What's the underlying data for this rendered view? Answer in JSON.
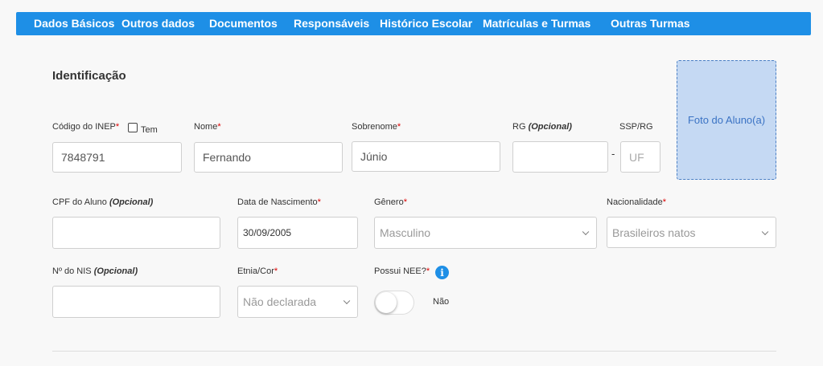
{
  "nav": {
    "tabs": [
      "Dados Básicos",
      "Outros dados",
      "Documentos",
      "Responsáveis",
      "Histórico Escolar",
      "Matrículas e Turmas",
      "Outras Turmas"
    ]
  },
  "section": {
    "title": "Identificação"
  },
  "form": {
    "inep": {
      "label": "Código do INEP",
      "req": "*",
      "checkbox_label": "Tem",
      "value": "7848791"
    },
    "nome": {
      "label": "Nome",
      "req": "*",
      "value": "Fernando"
    },
    "sobrenome": {
      "label": "Sobrenome",
      "req": "*",
      "value": "Júnio"
    },
    "rg": {
      "label": "RG",
      "opt": "(Opcional)",
      "value": ""
    },
    "ssp": {
      "label": "SSP/RG",
      "separator": "-",
      "placeholder": "UF"
    },
    "cpf": {
      "label": "CPF do Aluno",
      "opt": "(Opcional)",
      "value": ""
    },
    "nascimento": {
      "label": "Data de Nascimento",
      "req": "*",
      "value": "30/09/2005"
    },
    "genero": {
      "label": "Gênero",
      "req": "*",
      "value": "Masculino"
    },
    "nacionalidade": {
      "label": "Nacionalidade",
      "req": "*",
      "value": "Brasileiros natos"
    },
    "nis": {
      "label": "Nº do NIS",
      "opt": "(Opcional)",
      "value": ""
    },
    "etnia": {
      "label": "Etnia/Cor",
      "req": "*",
      "value": "Não declarada"
    },
    "nee": {
      "label": "Possui NEE?",
      "req": "*",
      "state_label": "Não",
      "on": false
    }
  },
  "photo": {
    "label": "Foto do Aluno(a)"
  },
  "colors": {
    "accent": "#1e8fe6",
    "photo_bg": "#c5d9f3",
    "required": "#d00000"
  }
}
